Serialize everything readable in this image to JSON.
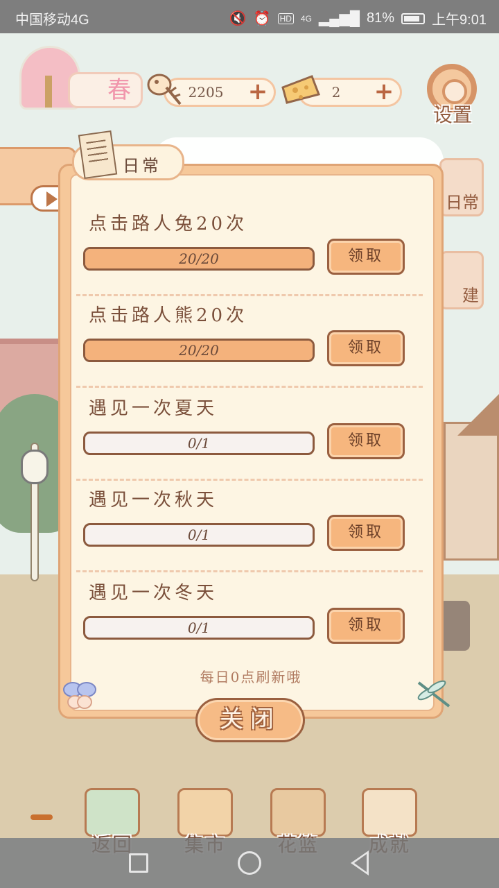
{
  "status_bar": {
    "carrier": "中国移动4G",
    "network": "4G",
    "hd": "HD",
    "battery": "81%",
    "time": "上午9:01"
  },
  "hud": {
    "season_label": "春",
    "fish_count": "2205",
    "cheese_count": "2",
    "settings_label": "设置",
    "side_daily_label": "日常",
    "side_build_label": "建"
  },
  "panel": {
    "tab_label": "日常",
    "tasks": [
      {
        "name": "点击路人兔20次",
        "progress_text": "20/20",
        "progress": 1.0,
        "claim_label": "领取"
      },
      {
        "name": "点击路人熊20次",
        "progress_text": "20/20",
        "progress": 1.0,
        "claim_label": "领取"
      },
      {
        "name": "遇见一次夏天",
        "progress_text": "0/1",
        "progress": 0.0,
        "claim_label": "领取"
      },
      {
        "name": "遇见一次秋天",
        "progress_text": "0/1",
        "progress": 0.0,
        "claim_label": "领取"
      },
      {
        "name": "遇见一次冬天",
        "progress_text": "0/1",
        "progress": 0.0,
        "claim_label": "领取"
      }
    ],
    "footnote": "每日0点刷新哦",
    "close_label": "关闭"
  },
  "bottom_nav": {
    "items": [
      {
        "label": "返回",
        "color": "#cfe3c8"
      },
      {
        "label": "集市",
        "color": "#f2d3a8"
      },
      {
        "label": "花篮",
        "color": "#e8c9a0"
      },
      {
        "label": "成就",
        "color": "#f4e2c7"
      }
    ]
  },
  "colors": {
    "accent": "#f6b67e",
    "border_brown": "#9a6040",
    "panel_bg": "#fdf5e3"
  }
}
